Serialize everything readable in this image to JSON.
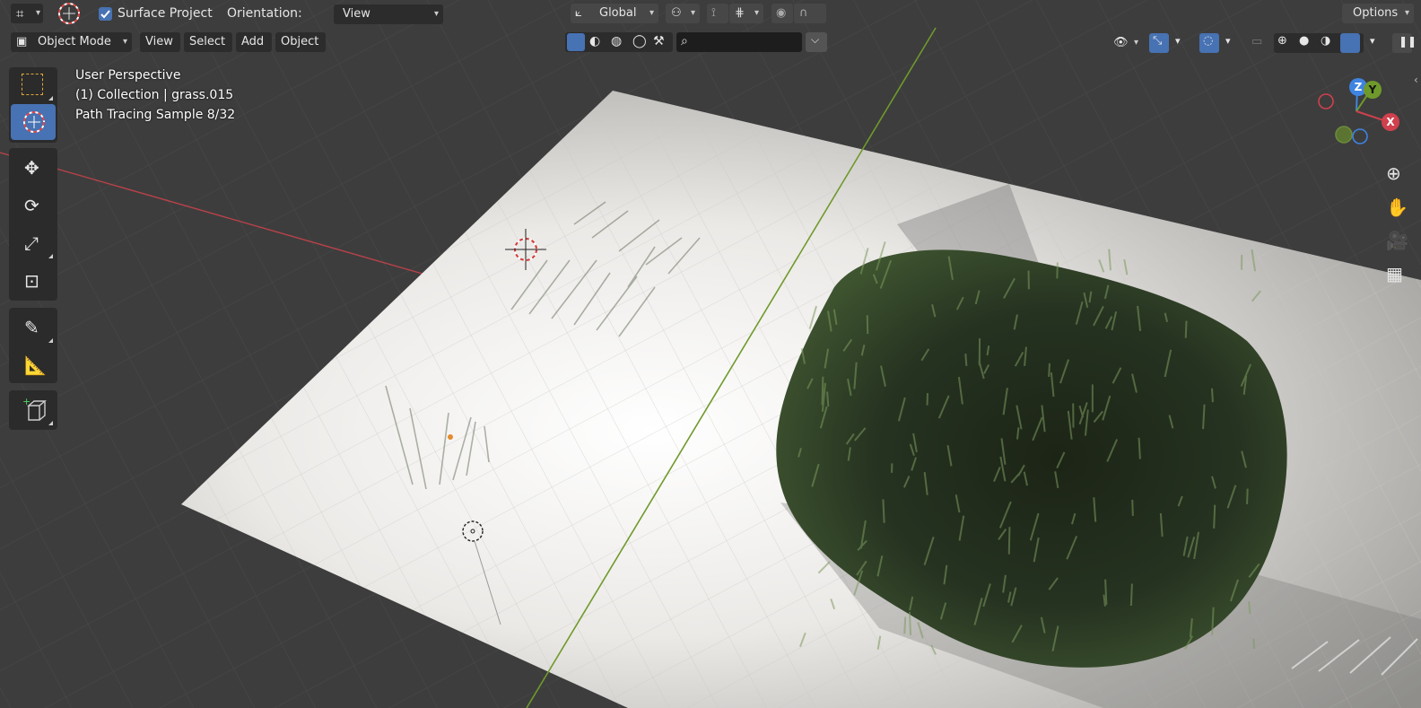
{
  "header": {
    "surface_project_label": "Surface Project",
    "surface_project_checked": true,
    "orientation_label": "Orientation:",
    "orientation_value": "View",
    "transform_orientation": "Global",
    "options_label": "Options"
  },
  "menubar": {
    "mode": "Object Mode",
    "view": "View",
    "select": "Select",
    "add": "Add",
    "object": "Object",
    "search_placeholder": ""
  },
  "overlay": {
    "line1": "User Perspective",
    "line2": "(1) Collection | grass.015",
    "line3": "Path Tracing Sample 8/32"
  },
  "gizmo": {
    "z": "Z",
    "y": "Y",
    "x": "X"
  },
  "colors": {
    "accent": "#4772b3",
    "x_axis": "#d0404d",
    "y_axis": "#6f9a2b",
    "z_axis": "#3f84e0"
  },
  "icons": [
    "editor-type-icon",
    "cursor-tool-icon",
    "transform-orientation-icon",
    "pivot-icon",
    "snap-icon",
    "proportional-edit-icon",
    "falloff-icon",
    "object-mode-icon",
    "select-box-icon",
    "move-icon",
    "rotate-icon",
    "scale-icon",
    "transform-icon",
    "annotate-icon",
    "measure-icon",
    "add-cube-icon",
    "visibility-icon",
    "gizmo-icon",
    "overlay-icon",
    "xray-icon",
    "wireframe-shading-icon",
    "solid-shading-icon",
    "material-shading-icon",
    "rendered-shading-icon",
    "zoom-icon",
    "pan-icon",
    "camera-icon",
    "grid-icon",
    "search-icon",
    "pause-icon"
  ]
}
